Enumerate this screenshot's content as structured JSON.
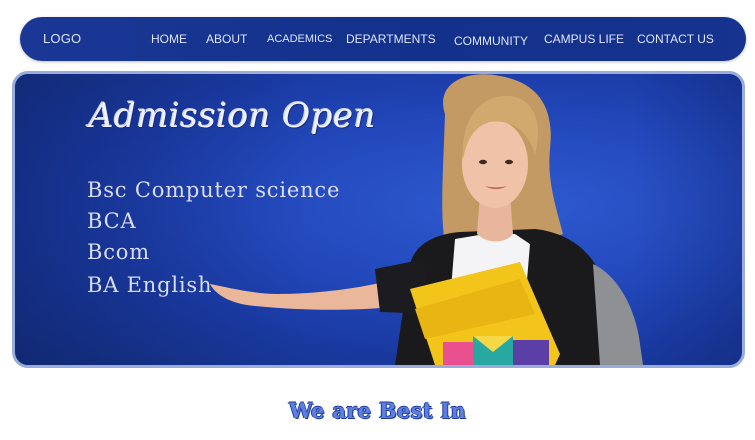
{
  "nav": {
    "logo": "LOGO",
    "links": [
      "HOME",
      "ABOUT",
      "ACADEMICS",
      "DEPARTMENTS",
      "COMMUNITY",
      "CAMPUS LIFE",
      "CONTACT US"
    ]
  },
  "hero": {
    "title": "Admission Open",
    "courses": [
      "Bsc Computer science",
      "BCA",
      "Bcom",
      "BA English"
    ]
  },
  "section": {
    "heading": "We are Best In"
  },
  "colors": {
    "nav_bg": "#15338f",
    "hero_bg": "#2349bd",
    "hero_border": "#9aacdc",
    "heading": "#5d7fe0"
  }
}
